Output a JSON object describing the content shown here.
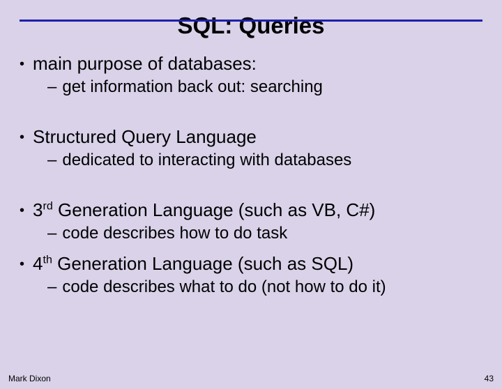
{
  "title": "SQL: Queries",
  "bullets": {
    "b1": "main purpose of databases:",
    "b1a": "get information back out: searching",
    "b2": "Structured Query Language",
    "b2a": "dedicated to interacting with databases",
    "b3_pre": "3",
    "b3_sup": "rd",
    "b3_post": " Generation Language (such as VB, C#)",
    "b3a": "code describes how to do task",
    "b4_pre": "4",
    "b4_sup": "th",
    "b4_post": " Generation Language (such as SQL)",
    "b4a": "code describes what to do (not how to do it)"
  },
  "footer": {
    "author": "Mark Dixon",
    "page": "43"
  }
}
